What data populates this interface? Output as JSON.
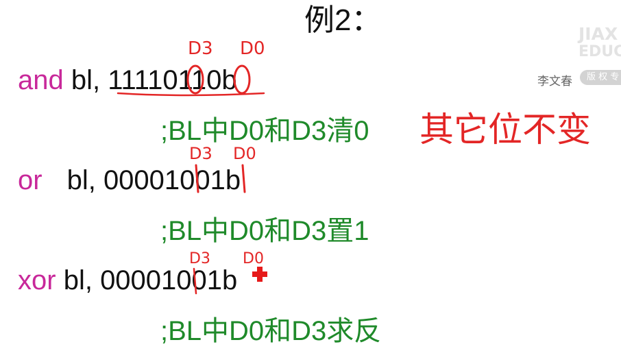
{
  "slide": {
    "title": "例2：",
    "instructions": [
      {
        "mnemonic": "and",
        "operands": "bl, 11110110b",
        "comment": ";BL中D0和D3清0"
      },
      {
        "mnemonic": "or",
        "operands": "bl, 00001001b",
        "comment": ";BL中D0和D3置1"
      },
      {
        "mnemonic": "xor",
        "operands": "bl, 00001001b",
        "comment": ";BL中D0和D3求反"
      }
    ]
  },
  "watermark": {
    "line1": "JIAX",
    "line2": "EDUCA",
    "badge": "版 权 专"
  },
  "author": "李文春",
  "annotations": {
    "bit_high": "D3",
    "bit_low": "D0",
    "note": "其它位不变"
  },
  "colors": {
    "mnemonic": "#c8289a",
    "operand": "#111111",
    "comment": "#1f8a2a",
    "ink": "#e32626"
  },
  "icons": {
    "cursor": "red-cross-cursor-icon"
  }
}
